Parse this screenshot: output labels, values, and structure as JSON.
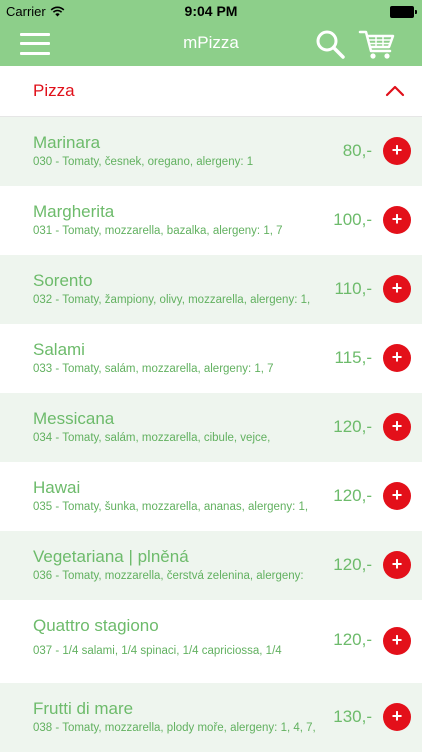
{
  "status_bar": {
    "carrier": "Carrier",
    "time": "9:04 PM",
    "wifi_icon": "wifi-icon",
    "battery_icon": "battery-icon"
  },
  "nav": {
    "title": "mPizza",
    "menu_icon": "hamburger-menu-icon",
    "search_icon": "search-icon",
    "cart_icon": "shopping-cart-icon",
    "bar_color": "#8dcf8a"
  },
  "section": {
    "title": "Pizza",
    "title_color": "#e0101a",
    "collapse_icon": "chevron-up-icon"
  },
  "colors": {
    "accent_green": "#6dbb6b",
    "add_button_red": "#e3101a",
    "row_shade": "#eef5ee"
  },
  "items": [
    {
      "name": "Marinara",
      "desc": "030 - Tomaty, česnek, oregano, alergeny: 1",
      "price": "80,-",
      "add": "+"
    },
    {
      "name": "Margherita",
      "desc": "031 - Tomaty, mozzarella, bazalka, alergeny: 1, 7",
      "price": "100,-",
      "add": "+"
    },
    {
      "name": "Sorento",
      "desc": "032 - Tomaty, žampiony, olivy, mozzarella, alergeny: 1,",
      "price": "110,-",
      "add": "+"
    },
    {
      "name": "Salami",
      "desc": "033 - Tomaty, salám, mozzarella, alergeny: 1, 7",
      "price": "115,-",
      "add": "+"
    },
    {
      "name": "Messicana",
      "desc": "034 - Tomaty, salám, mozzarella, cibule, vejce,",
      "price": "120,-",
      "add": "+"
    },
    {
      "name": "Hawai",
      "desc": "035 - Tomaty, šunka, mozzarella, ananas, alergeny: 1,",
      "price": "120,-",
      "add": "+"
    },
    {
      "name": "Vegetariana | plněná",
      "desc": "036 - Tomaty, mozzarella, čerstvá zelenina, alergeny:",
      "price": "120,-",
      "add": "+"
    },
    {
      "name": "Quattro stagiono",
      "desc": "037 - 1/4 salami, 1/4 spinaci, 1/4 capriciossa, 1/4",
      "price": "120,-",
      "add": "+"
    },
    {
      "name": "Frutti di mare",
      "desc": "038 - Tomaty, mozzarella, plody moře, alergeny: 1, 4, 7,",
      "price": "130,-",
      "add": "+"
    }
  ]
}
